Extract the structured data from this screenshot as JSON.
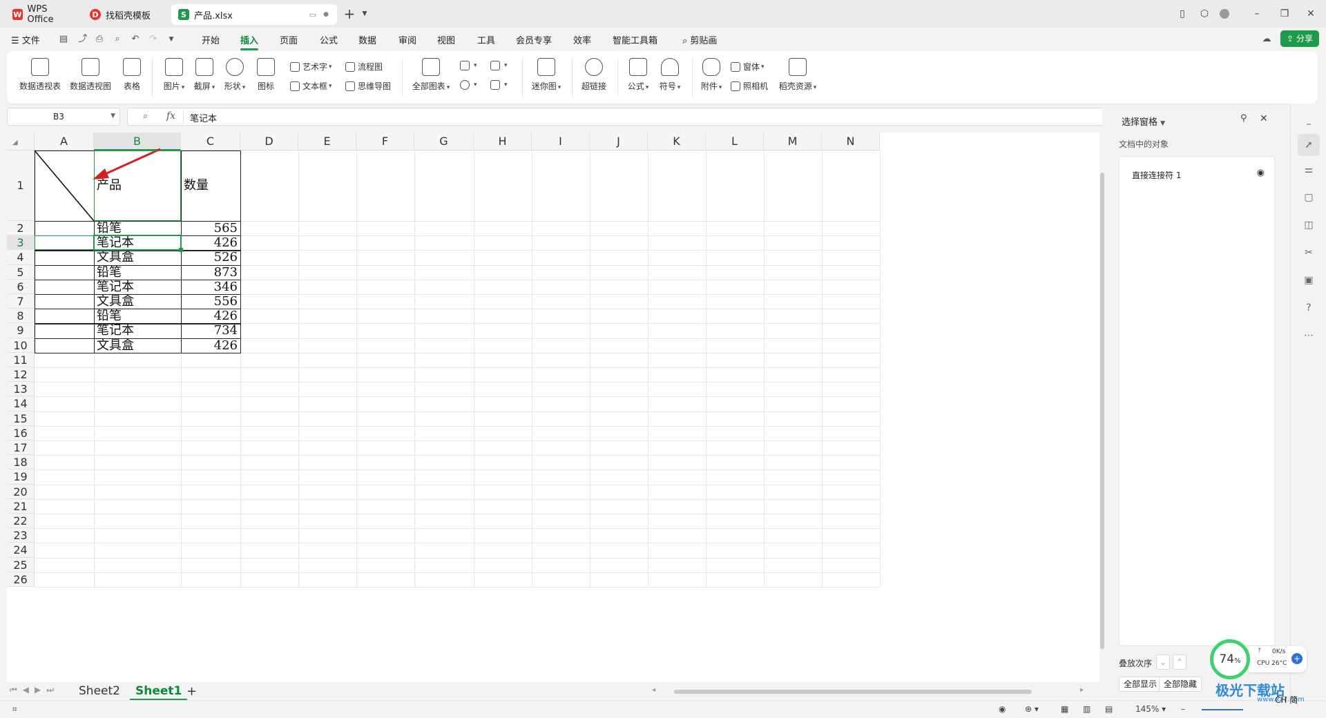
{
  "tabs": [
    {
      "label": "WPS Office"
    },
    {
      "label": "找稻壳模板"
    },
    {
      "label": "产品.xlsx"
    }
  ],
  "menu": {
    "file": "文件",
    "items": [
      "开始",
      "插入",
      "页面",
      "公式",
      "数据",
      "审阅",
      "视图",
      "工具",
      "会员专享",
      "效率",
      "智能工具箱"
    ],
    "active": "插入",
    "search": "剪贴画",
    "share": "分享"
  },
  "ribbon": {
    "big": [
      "数据透视表",
      "数据透视图",
      "表格",
      "图片",
      "截屏",
      "形状",
      "图标",
      "全部图表",
      "迷你图",
      "超链接",
      "公式",
      "符号",
      "附件",
      "稻壳资源"
    ],
    "small": [
      "艺术字",
      "流程图",
      "文本框",
      "思维导图",
      "窗体",
      "照相机"
    ]
  },
  "formula": {
    "namebox": "B3",
    "fx": "fx",
    "value": "笔记本"
  },
  "columns": [
    "A",
    "B",
    "C",
    "D",
    "E",
    "F",
    "G",
    "H",
    "I",
    "J",
    "K",
    "L",
    "M",
    "N"
  ],
  "rows": [
    "1",
    "2",
    "3",
    "4",
    "5",
    "6",
    "7",
    "8",
    "9",
    "10",
    "11",
    "12",
    "13",
    "14",
    "15",
    "16",
    "17",
    "18",
    "19",
    "20",
    "21",
    "22",
    "23",
    "24",
    "25",
    "26"
  ],
  "table": {
    "header_product": "产品",
    "header_qty": "数量",
    "rows": [
      {
        "product": "铅笔",
        "qty": "565"
      },
      {
        "product": "笔记本",
        "qty": "426"
      },
      {
        "product": "文具盒",
        "qty": "526"
      },
      {
        "product": "铅笔",
        "qty": "873"
      },
      {
        "product": "笔记本",
        "qty": "346"
      },
      {
        "product": "文具盒",
        "qty": "556"
      },
      {
        "product": "铅笔",
        "qty": "426"
      },
      {
        "product": "笔记本",
        "qty": "734"
      },
      {
        "product": "文具盒",
        "qty": "426"
      }
    ]
  },
  "sheets": [
    "Sheet2",
    "Sheet1"
  ],
  "active_sheet": "Sheet1",
  "panel": {
    "title": "选择窗格",
    "subtitle": "文档中的对象",
    "objects": [
      "直接连接符 1"
    ],
    "order_label": "叠放次序",
    "show_all": "全部显示",
    "hide_all": "全部隐藏"
  },
  "status": {
    "zoom": "145%",
    "cpu_pct": "74",
    "net": "0K/s",
    "cpu_temp": "CPU 26°C",
    "ime": "CH 简"
  },
  "watermark": "极光下载站",
  "watermark_sub": "www.xz7.com",
  "colors": {
    "accent": "#1f9a4a",
    "arrow": "#d42020",
    "gauge": "#3dd26e"
  }
}
